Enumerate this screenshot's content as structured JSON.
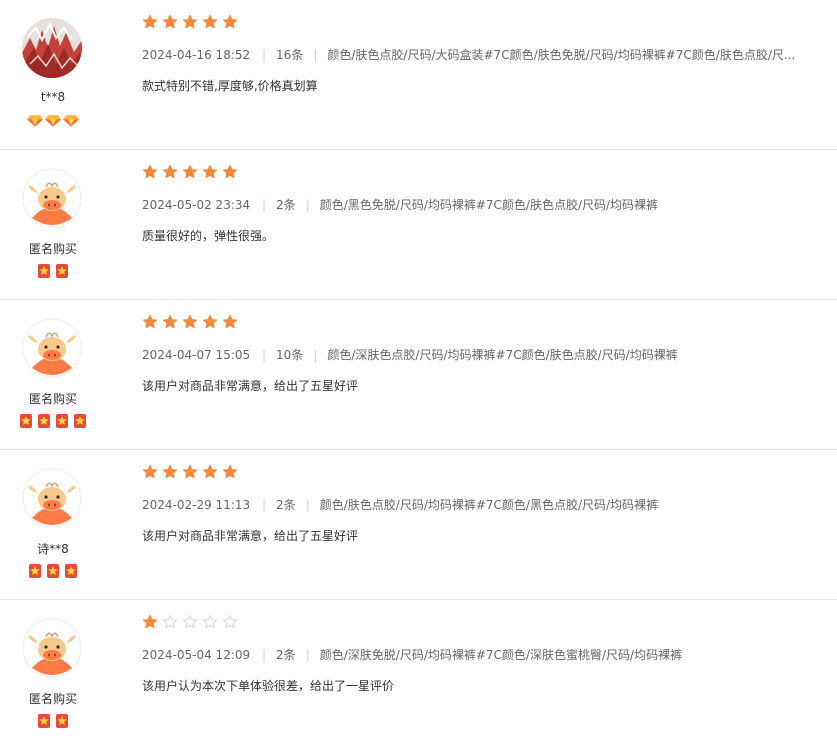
{
  "reviews": [
    {
      "username": "t**8",
      "avatar": "photo-avatar",
      "badge_type": "diamond",
      "badge_count": 3,
      "rating": 5,
      "date": "2024-04-16 18:52",
      "count": "16条",
      "spec": "颜色/肤色点胶/尺码/大码盒装#7C颜色/肤色免脱/尺码/均码裸裤#7C颜色/肤色点胶/尺...",
      "comment": "款式特别不错,厚度够,价格真划算"
    },
    {
      "username": "匿名购买",
      "avatar": "bull-avatar",
      "badge_type": "star-medal",
      "badge_count": 2,
      "rating": 5,
      "date": "2024-05-02 23:34",
      "count": "2条",
      "spec": "颜色/黑色免脱/尺码/均码裸裤#7C颜色/肤色点胶/尺码/均码裸裤",
      "comment": "质量很好的，弹性很强。"
    },
    {
      "username": "匿名购买",
      "avatar": "bull-avatar",
      "badge_type": "star-medal",
      "badge_count": 4,
      "rating": 5,
      "date": "2024-04-07 15:05",
      "count": "10条",
      "spec": "颜色/深肤色点胶/尺码/均码裸裤#7C颜色/肤色点胶/尺码/均码裸裤",
      "comment": "该用户对商品非常满意，给出了五星好评"
    },
    {
      "username": "诗**8",
      "avatar": "bull-avatar",
      "badge_type": "star-medal",
      "badge_count": 3,
      "rating": 5,
      "date": "2024-02-29 11:13",
      "count": "2条",
      "spec": "颜色/肤色点胶/尺码/均码裸裤#7C颜色/黑色点胶/尺码/均码裸裤",
      "comment": "该用户对商品非常满意，给出了五星好评"
    },
    {
      "username": "匿名购买",
      "avatar": "bull-avatar",
      "badge_type": "star-medal",
      "badge_count": 2,
      "rating": 1,
      "date": "2024-05-04 12:09",
      "count": "2条",
      "spec": "颜色/深肤免脱/尺码/均码裸裤#7C颜色/深肤色蜜桃臀/尺码/均码裸裤",
      "comment": "该用户认为本次下单体验很差，给出了一星评价"
    }
  ],
  "colors": {
    "star_filled": "#f5883b",
    "star_empty": "#d9d9d9",
    "bull_orange": "#ff7a45"
  }
}
